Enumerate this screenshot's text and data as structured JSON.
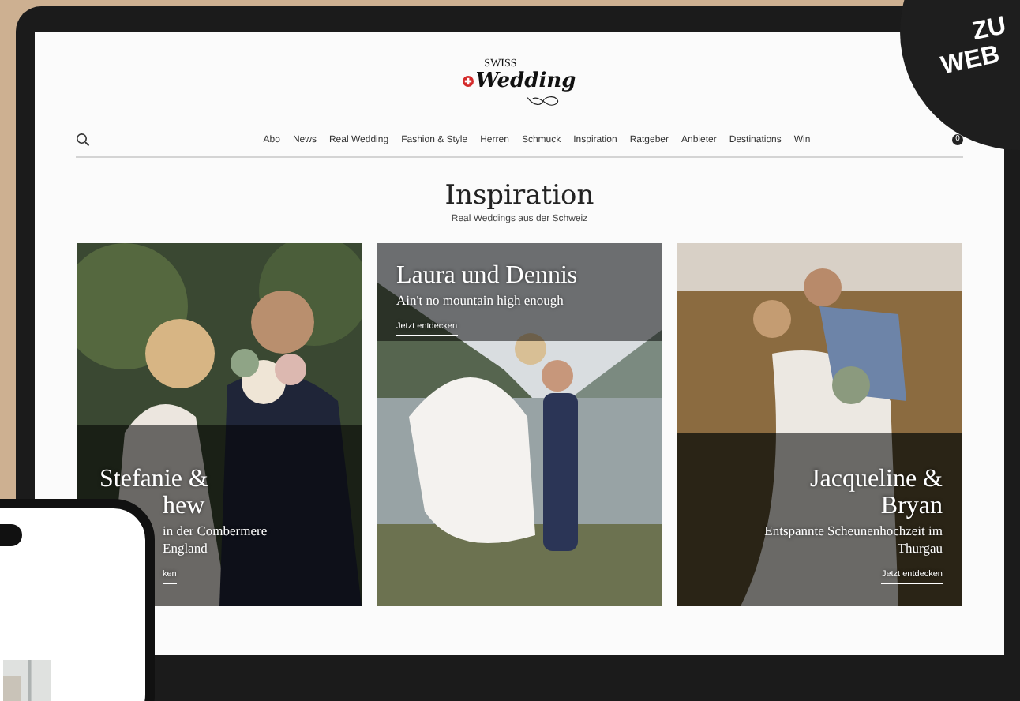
{
  "site": {
    "logo": {
      "top": "SWISS",
      "name": "Wedding"
    },
    "nav": [
      "Abo",
      "News",
      "Real Wedding",
      "Fashion & Style",
      "Herren",
      "Schmuck",
      "Inspiration",
      "Ratgeber",
      "Anbieter",
      "Destinations",
      "Win"
    ],
    "cart_count": "0"
  },
  "page": {
    "title": "Inspiration",
    "subtitle": "Real Weddings aus der Schweiz"
  },
  "cards": [
    {
      "kind": "bottom-left",
      "title_lines": [
        "Stefanie &",
        "hew"
      ],
      "subtitle_lines": [
        "in der Combermere",
        "England"
      ],
      "link": "ken"
    },
    {
      "kind": "top-left",
      "title_lines": [
        "Laura und Dennis"
      ],
      "subtitle_lines": [
        "Ain't no mountain high enough"
      ],
      "link": "Jetzt entdecken"
    },
    {
      "kind": "bottom-right",
      "title_lines": [
        "Jacqueline &",
        "Bryan"
      ],
      "subtitle_lines": [
        "Entspannte Scheunenhochzeit im",
        "Thurgau"
      ],
      "link": "Jetzt entdecken"
    }
  ],
  "badge": {
    "lines": [
      "ZU",
      "WEB"
    ]
  }
}
